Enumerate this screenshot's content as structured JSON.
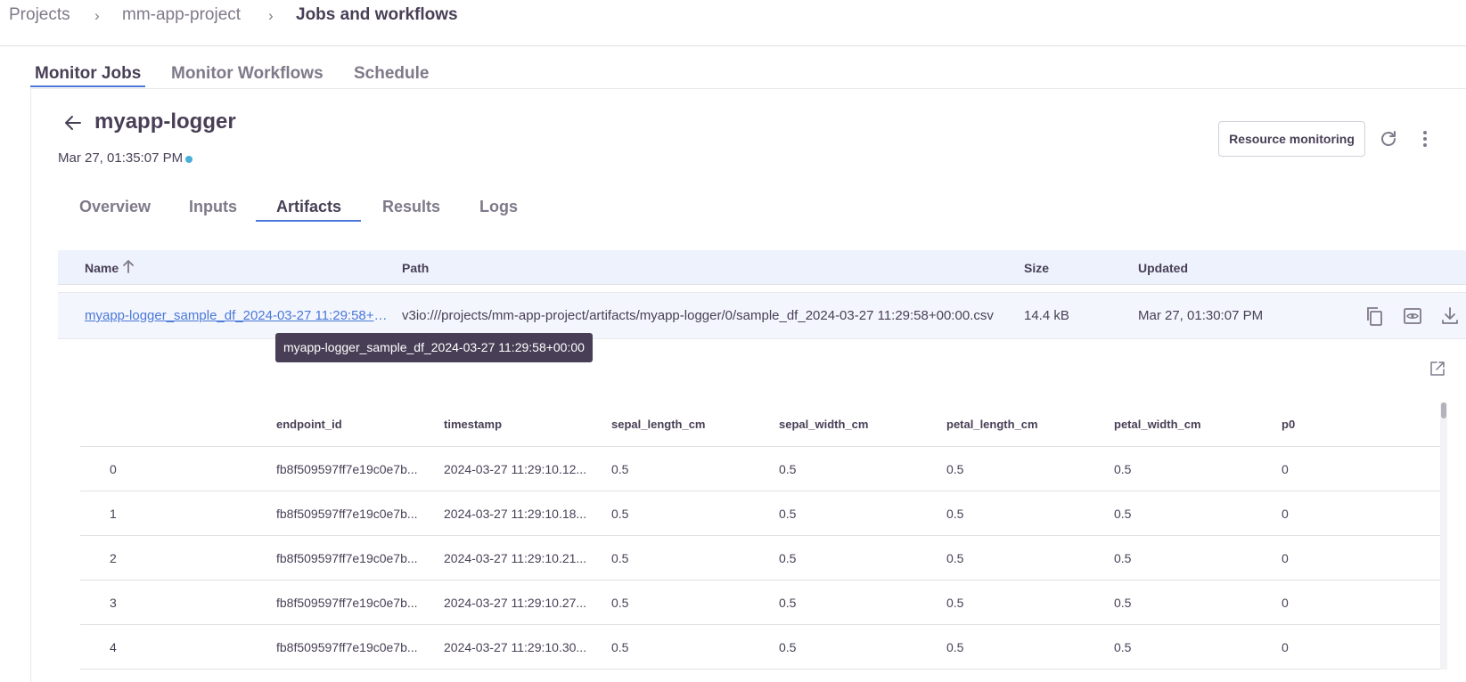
{
  "breadcrumb": {
    "projects": "Projects",
    "project": "mm-app-project",
    "current": "Jobs and workflows",
    "separator": "›"
  },
  "main_tabs": [
    "Monitor Jobs",
    "Monitor Workflows",
    "Schedule"
  ],
  "job": {
    "name": "myapp-logger",
    "date": "Mar 27, 01:35:07 PM",
    "status_color": "#49afd9"
  },
  "actions": {
    "resource_monitoring": "Resource monitoring"
  },
  "detail_tabs": [
    "Overview",
    "Inputs",
    "Artifacts",
    "Results",
    "Logs"
  ],
  "artifacts": {
    "columns": [
      "Name",
      "Path",
      "Size",
      "Updated"
    ],
    "rows": [
      {
        "name": "myapp-logger_sample_df_2024-03-27 11:29:58+0...",
        "path": "v3io:///projects/mm-app-project/artifacts/myapp-logger/0/sample_df_2024-03-27 11:29:58+00:00.csv",
        "size": "14.4 kB",
        "updated": "Mar 27, 01:30:07 PM"
      }
    ],
    "tooltip": "myapp-logger_sample_df_2024-03-27 11:29:58+00:00"
  },
  "preview": {
    "columns": [
      "",
      "endpoint_id",
      "timestamp",
      "sepal_length_cm",
      "sepal_width_cm",
      "petal_length_cm",
      "petal_width_cm",
      "p0"
    ],
    "rows": [
      [
        "0",
        "fb8f509597ff7e19c0e7b...",
        "2024-03-27 11:29:10.12...",
        "0.5",
        "0.5",
        "0.5",
        "0.5",
        "0"
      ],
      [
        "1",
        "fb8f509597ff7e19c0e7b...",
        "2024-03-27 11:29:10.18...",
        "0.5",
        "0.5",
        "0.5",
        "0.5",
        "0"
      ],
      [
        "2",
        "fb8f509597ff7e19c0e7b...",
        "2024-03-27 11:29:10.21...",
        "0.5",
        "0.5",
        "0.5",
        "0.5",
        "0"
      ],
      [
        "3",
        "fb8f509597ff7e19c0e7b...",
        "2024-03-27 11:29:10.27...",
        "0.5",
        "0.5",
        "0.5",
        "0.5",
        "0"
      ],
      [
        "4",
        "fb8f509597ff7e19c0e7b...",
        "2024-03-27 11:29:10.30...",
        "0.5",
        "0.5",
        "0.5",
        "0.5",
        "0"
      ]
    ]
  },
  "colors": {
    "accent": "#4a78d9",
    "text": "#483f56",
    "muted": "#7f7989",
    "header_bg": "#eef2fd"
  }
}
